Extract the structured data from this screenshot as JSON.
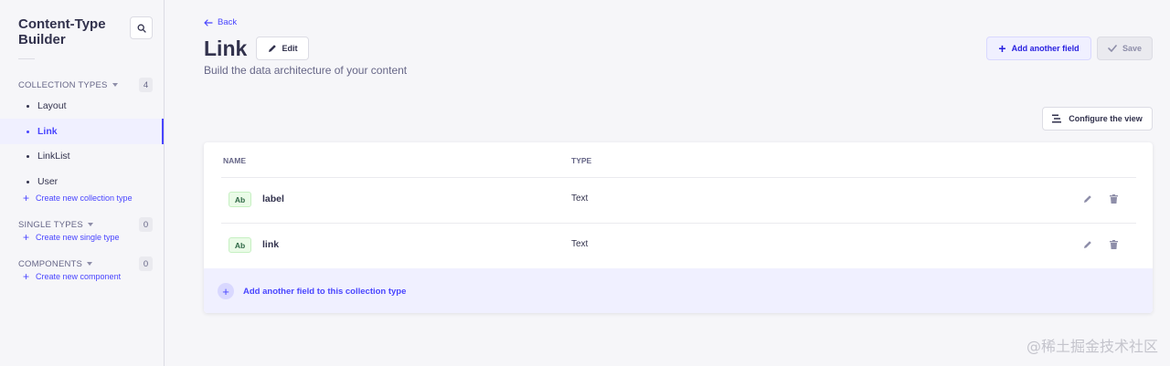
{
  "sidebar": {
    "title": "Content-Type Builder",
    "collection_types": {
      "label": "COLLECTION TYPES",
      "count": "4",
      "items": [
        {
          "label": "Layout"
        },
        {
          "label": "Link"
        },
        {
          "label": "LinkList"
        },
        {
          "label": "User"
        }
      ],
      "create_label": "Create new collection type"
    },
    "single_types": {
      "label": "SINGLE TYPES",
      "count": "0",
      "create_label": "Create new single type"
    },
    "components": {
      "label": "COMPONENTS",
      "count": "0",
      "create_label": "Create new component"
    }
  },
  "header": {
    "back_label": "Back",
    "title": "Link",
    "edit_label": "Edit",
    "subtitle": "Build the data architecture of your content",
    "add_field_label": "Add another field",
    "save_label": "Save"
  },
  "toolbar": {
    "configure_label": "Configure the view"
  },
  "table": {
    "columns": [
      "NAME",
      "TYPE"
    ],
    "rows": [
      {
        "badge": "Ab",
        "name": "label",
        "type": "Text"
      },
      {
        "badge": "Ab",
        "name": "link",
        "type": "Text"
      }
    ],
    "add_field_label": "Add another field to this collection type"
  },
  "watermark": "@稀土掘金技术社区",
  "colors": {
    "accent": "#4945ff",
    "background": "#f6f6f9",
    "text_badge": "#2f6846"
  }
}
